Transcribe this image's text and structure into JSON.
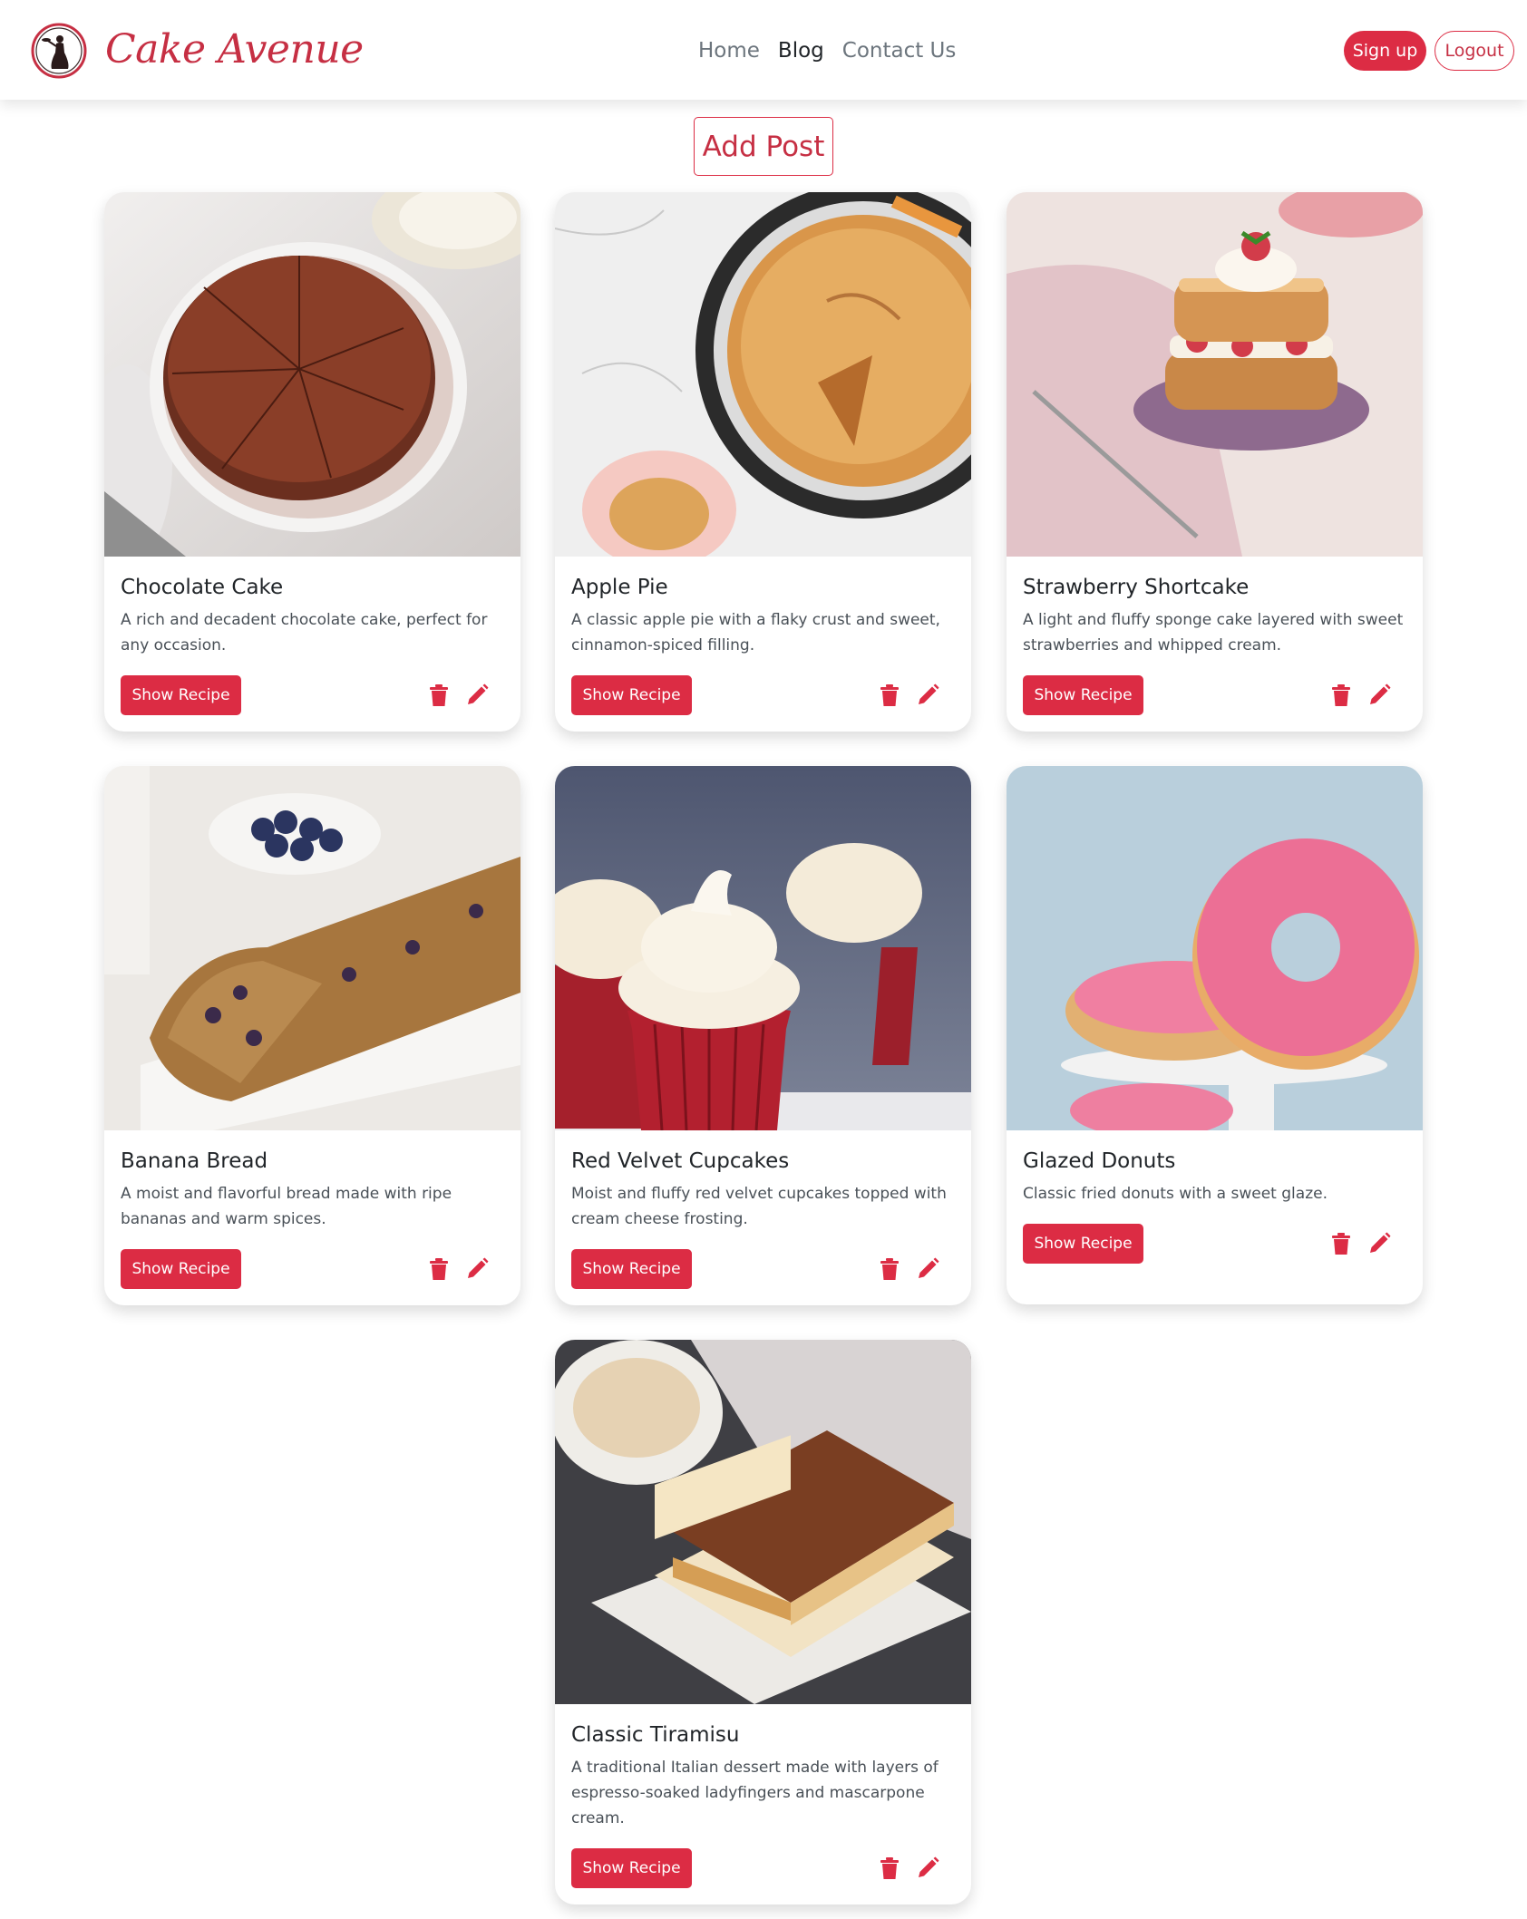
{
  "brand": {
    "name": "Cake Avenue",
    "logo": "woman-silhouette-logo"
  },
  "nav": {
    "links": [
      {
        "label": "Home",
        "active": false
      },
      {
        "label": "Blog",
        "active": true
      },
      {
        "label": "Contact Us",
        "active": false
      }
    ],
    "signup_label": "Sign up",
    "logout_label": "Logout"
  },
  "add_post_label": "Add Post",
  "colors": {
    "accent": "#dc2c44",
    "brand_text": "#c62f43"
  },
  "icons": {
    "delete": "trash-icon",
    "edit": "pencil-icon"
  },
  "posts": [
    {
      "title": "Chocolate Cake",
      "description": "A rich and decadent chocolate cake, perfect for any occasion.",
      "button": "Show Recipe"
    },
    {
      "title": "Apple Pie",
      "description": "A classic apple pie with a flaky crust and sweet, cinnamon-spiced filling.",
      "button": "Show Recipe"
    },
    {
      "title": "Strawberry Shortcake",
      "description": "A light and fluffy sponge cake layered with sweet strawberries and whipped cream.",
      "button": "Show Recipe"
    },
    {
      "title": "Banana Bread",
      "description": "A moist and flavorful bread made with ripe bananas and warm spices.",
      "button": "Show Recipe"
    },
    {
      "title": "Red Velvet Cupcakes",
      "description": "Moist and fluffy red velvet cupcakes topped with cream cheese frosting.",
      "button": "Show Recipe"
    },
    {
      "title": "Glazed Donuts",
      "description": "Classic fried donuts with a sweet glaze.",
      "button": "Show Recipe"
    },
    {
      "title": "Classic Tiramisu",
      "description": "A traditional Italian dessert made with layers of espresso-soaked ladyfingers and mascarpone cream.",
      "button": "Show Recipe"
    }
  ]
}
